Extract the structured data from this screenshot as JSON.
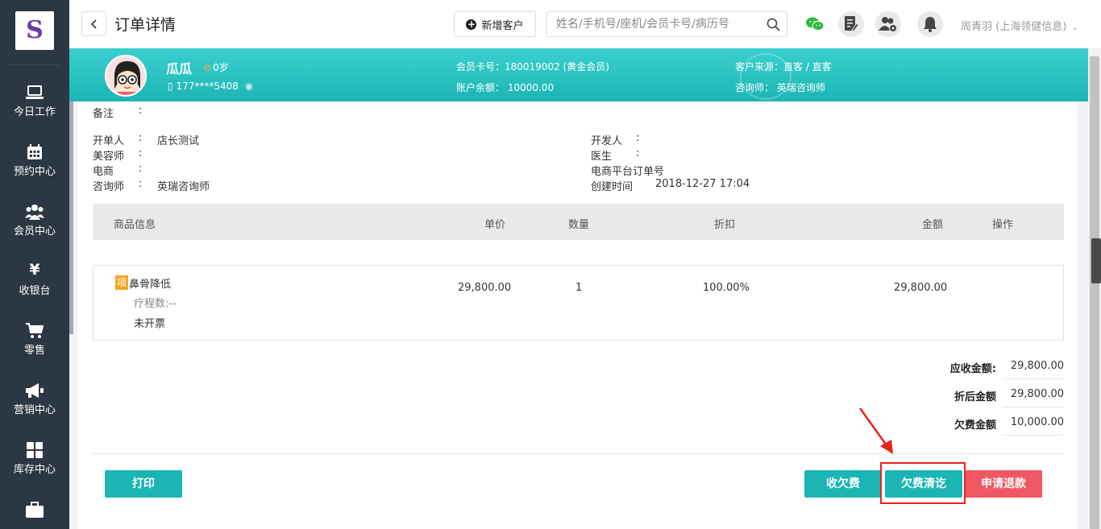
{
  "sidebar": {
    "items": [
      {
        "label": "今日工作",
        "icon": "laptop-icon"
      },
      {
        "label": "预约中心",
        "icon": "calendar-icon"
      },
      {
        "label": "会员中心",
        "icon": "members-icon"
      },
      {
        "label": "收银台",
        "icon": "yen-icon"
      },
      {
        "label": "零售",
        "icon": "cart-icon"
      },
      {
        "label": "营销中心",
        "icon": "megaphone-icon"
      },
      {
        "label": "库存中心",
        "icon": "grid-icon"
      }
    ]
  },
  "header": {
    "title": "订单详情",
    "add_customer": "新增客户",
    "search_placeholder": "姓名/手机号/座机/会员卡号/病历号",
    "user": "周青羽 (上海领健信息)"
  },
  "customer": {
    "name": "瓜瓜",
    "age": "0岁",
    "phone": "177****5408",
    "card_no": "会员卡号：180019002 (黄金会员)",
    "balance": "账户余额： 10000.00",
    "source": "客户来源：直客 / 直客",
    "consultant": "咨询师： 英瑞咨询师"
  },
  "order": {
    "remark_label": "备注",
    "creator_label": "开单人",
    "creator": "店长测试",
    "beautician_label": "美容师",
    "ecommerce_label": "电商",
    "consultant_label": "咨询师",
    "consultant": "英瑞咨询师",
    "developer_label": "开发人",
    "doctor_label": "医生",
    "ecom_order_label": "电商平台订单号",
    "created_label": "创建时间",
    "created": "2018-12-27 17:04",
    "colon": ":"
  },
  "table": {
    "headers": [
      "商品信息",
      "单价",
      "数量",
      "折扣",
      "金额",
      "操作"
    ],
    "rows": [
      {
        "tag": "项",
        "name": "鼻骨降低",
        "course": "疗程数:--",
        "invoice": "未开票",
        "price": "29,800.00",
        "qty": "1",
        "discount": "100.00%",
        "amount": "29,800.00"
      }
    ]
  },
  "summary": {
    "receivable_label": "应收金额:",
    "receivable": "29,800.00",
    "discounted_label": "折后金额",
    "discounted": "29,800.00",
    "owed_label": "欠费金额",
    "owed": "10,000.00"
  },
  "actions": {
    "print": "打印",
    "collect_debt": "收欠费",
    "clear_debt": "欠费清讫",
    "refund": "申请退款"
  },
  "colors": {
    "teal": "#1cb5b4",
    "sidebar": "#2c3744",
    "refund": "#ee5864",
    "highlight": "#e8211d"
  }
}
